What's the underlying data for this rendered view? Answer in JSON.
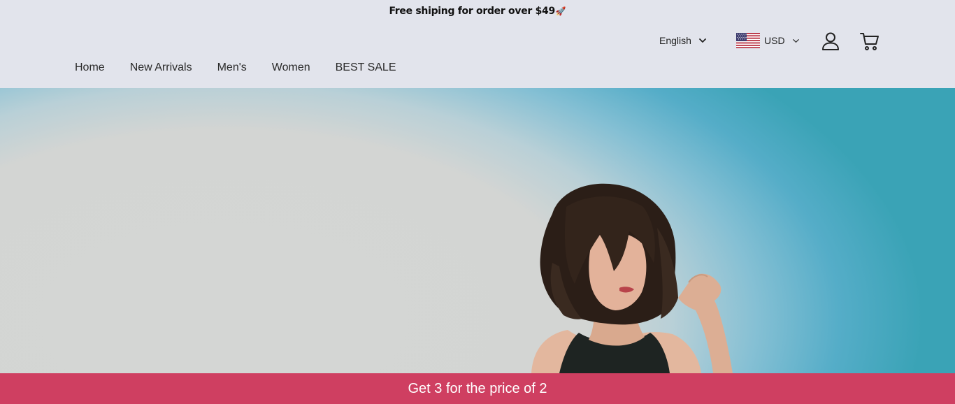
{
  "announcement": {
    "text": "Free shiping for order over $49",
    "icon": "rocket-icon"
  },
  "header": {
    "language": {
      "selected": "English",
      "icon": "chevron-down-icon"
    },
    "currency": {
      "selected": "USD",
      "flag_icon": "us-flag-icon",
      "icon": "chevron-down-icon"
    },
    "account_icon": "user-icon",
    "cart_icon": "cart-icon"
  },
  "nav": {
    "items": [
      {
        "label": "Home"
      },
      {
        "label": "New Arrivals"
      },
      {
        "label": "Men's"
      },
      {
        "label": "Women"
      },
      {
        "label": "BEST SALE"
      }
    ]
  },
  "promo": {
    "text": "Get 3 for the price of 2"
  },
  "colors": {
    "header_bg": "#e2e4ec",
    "promo_bg": "#cf3f61",
    "sky_accent": "#3aa3b6"
  }
}
